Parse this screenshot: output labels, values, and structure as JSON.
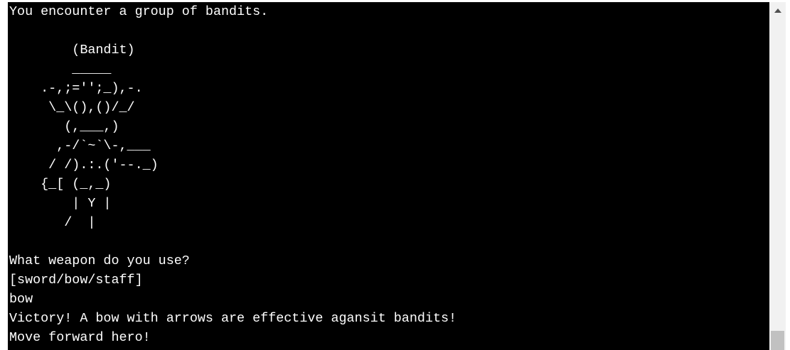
{
  "terminal": {
    "background": "#000000",
    "foreground": "#ffffff",
    "lines": [
      "You encounter a group of bandits.",
      "",
      "        (Bandit)",
      "        _____",
      "    .-,;='';_),-.",
      "     \\_\\(),()/_/",
      "       (,___,)",
      "      ,-/`~`\\-,___",
      "     / /).:.('--._)",
      "    {_[ (_,_)",
      "        | Y |",
      "       /  |",
      "",
      "What weapon do you use?",
      "[sword/bow/staff]",
      "bow",
      "Victory! A bow with arrows are effective agansit bandits!",
      "Move forward hero!"
    ]
  },
  "scrollbar": {
    "up_arrow_icon": "triangle-up-icon",
    "position": "bottom"
  }
}
